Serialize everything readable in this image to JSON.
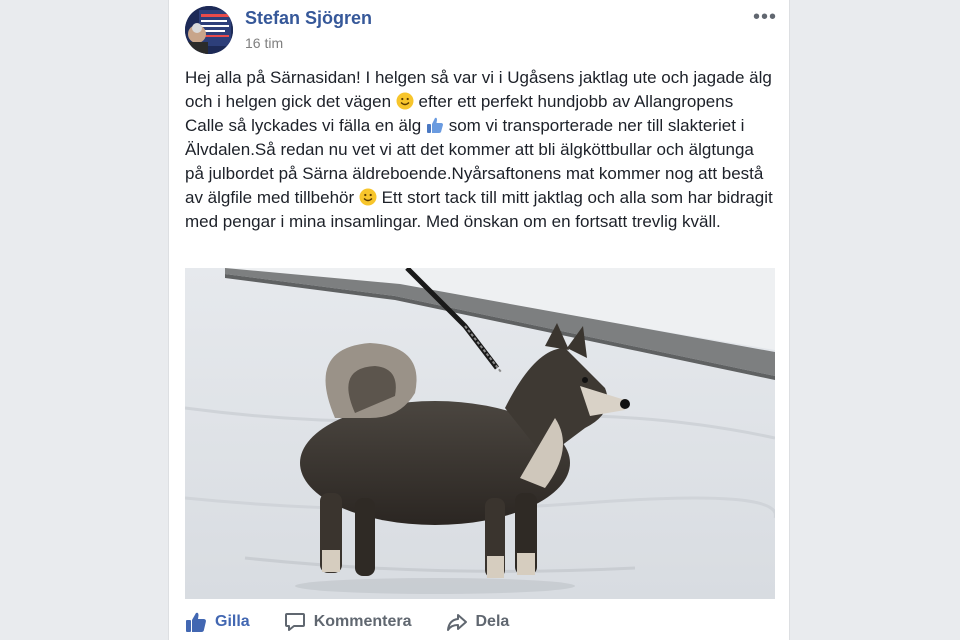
{
  "post": {
    "author": "Stefan Sjögren",
    "time": "16 tim",
    "more_label": "•••",
    "text_parts": [
      "Hej alla på Särnasidan! I helgen så var vi i Ugåsens jaktlag ute och jagade älg och i helgen gick det vägen ",
      " efter ett perfekt hundjobb av Allangropens Calle så lyckades vi fälla en älg ",
      " som vi transporterade ner till slakteriet i Älvdalen.Så redan nu vet vi att det kommer att bli älgköttbullar och älgtunga på julbordet på Särna äldreboende.Nyårsaftonens mat kommer nog att bestå av älgfile med tillbehör ",
      " Ett stort tack till mitt jaktlag och alla som har bidragit med pengar i mina insamlingar. Med önskan om en fortsatt trevlig kväll."
    ]
  },
  "actions": {
    "like": "Gilla",
    "comment": "Kommentera",
    "share": "Dela"
  },
  "colors": {
    "link_blue": "#365899",
    "like_blue": "#4267b2",
    "text": "#1d2129",
    "muted": "#606770",
    "page_bg": "#e9ebee"
  },
  "icons": [
    "smile-emoji-icon",
    "thumbs-up-emoji-icon",
    "like-icon",
    "comment-icon",
    "share-icon",
    "more-icon"
  ]
}
